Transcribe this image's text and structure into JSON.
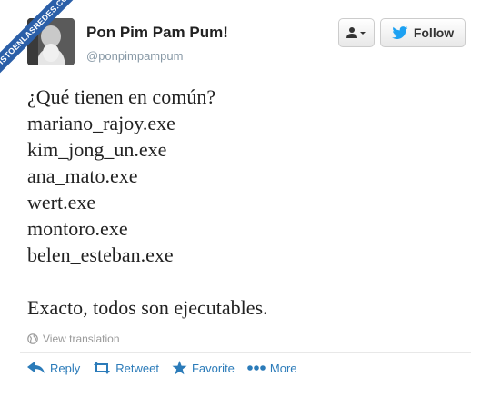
{
  "watermark": "VISTOENLASREDES.COM",
  "user": {
    "display_name": "Pon Pim Pam Pum!",
    "handle": "@ponpimpampum"
  },
  "buttons": {
    "user_menu_icon": "person-dropdown-icon",
    "follow_label": "Follow",
    "follow_icon": "bird-icon"
  },
  "tweet": {
    "lines": [
      "¿Qué tienen en común?",
      "mariano_rajoy.exe",
      "kim_jong_un.exe",
      "ana_mato.exe",
      "wert.exe",
      "montoro.exe",
      "belen_esteban.exe",
      "",
      "Exacto, todos son ejecutables."
    ]
  },
  "translation": {
    "label": "View translation",
    "icon": "globe-icon"
  },
  "actions": [
    {
      "label": "Reply",
      "icon": "reply-icon"
    },
    {
      "label": "Retweet",
      "icon": "retweet-icon"
    },
    {
      "label": "Favorite",
      "icon": "star-icon"
    },
    {
      "label": "More",
      "icon": "more-icon"
    }
  ],
  "colors": {
    "link": "#2b7bb9",
    "watermark": "#2b5fa8",
    "follow_bird": "#1da1f2"
  }
}
